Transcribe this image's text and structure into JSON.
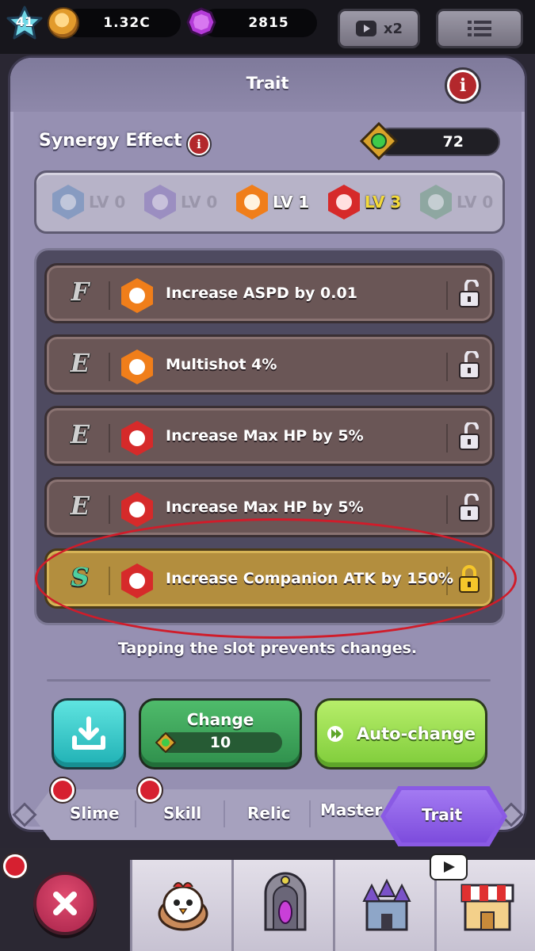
{
  "topbar": {
    "level": "41",
    "coins": "1.32C",
    "gems": "2815",
    "video_multiplier": "x2",
    "icons": {
      "level": "star-icon",
      "coin": "gold-coin-icon",
      "gem": "purple-gem-icon",
      "video": "video-play-icon",
      "menu": "list-menu-icon"
    }
  },
  "panel": {
    "title": "Trait",
    "synergy_label": "Synergy Effect",
    "synergy_count": "72",
    "synergy_levels": [
      {
        "label": "LV 0",
        "color": "#4f7fb8",
        "state": "inactive"
      },
      {
        "label": "LV 0",
        "color": "#7a62b8",
        "state": "inactive"
      },
      {
        "label": "LV 1",
        "color": "#f07e1a",
        "state": "active"
      },
      {
        "label": "LV 3",
        "color": "#d62a2a",
        "state": "highlighted"
      },
      {
        "label": "LV 0",
        "color": "#5e9a72",
        "state": "inactive"
      }
    ],
    "slots": [
      {
        "grade": "F",
        "icon_color": "#f07e1a",
        "text": "Increase ASPD by 0.01",
        "locked": false
      },
      {
        "grade": "E",
        "icon_color": "#f07e1a",
        "text": "Multishot 4%",
        "locked": false
      },
      {
        "grade": "E",
        "icon_color": "#d62a2a",
        "text": "Increase Max HP by 5%",
        "locked": false
      },
      {
        "grade": "E",
        "icon_color": "#d62a2a",
        "text": "Increase Max HP by 5%",
        "locked": false
      },
      {
        "grade": "S",
        "icon_color": "#d62a2a",
        "text": "Increase Companion ATK by 150%",
        "locked": true
      }
    ],
    "hint": "Tapping the slot prevents changes.",
    "buttons": {
      "change_label": "Change",
      "change_cost": "10",
      "auto_change_label": "Auto-change"
    }
  },
  "tabs": [
    "Slime",
    "Skill",
    "Relic",
    "Master",
    "Trait"
  ],
  "active_tab": "Trait",
  "colors": {
    "panel": "#9690b2",
    "gold_slot": "#b38e3e",
    "accent_purple": "#8a5ae4",
    "highlight": "#d01c2a"
  }
}
